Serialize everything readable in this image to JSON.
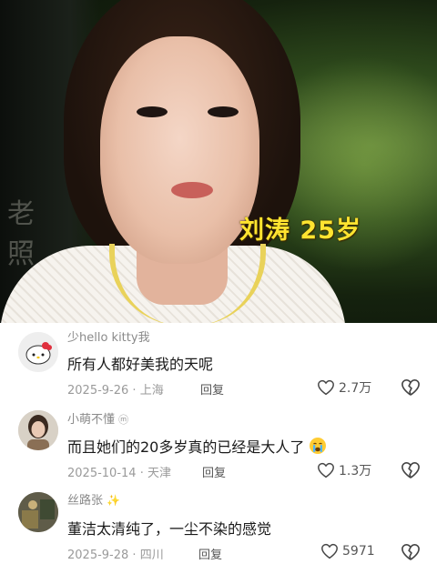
{
  "photo": {
    "caption": "刘涛 25岁",
    "watermark_glyphs": "老照"
  },
  "comments": [
    {
      "username": "少hello kitty我",
      "text": "所有人都好美我的天呢",
      "date": "2025-9-26",
      "location": "上海",
      "reply_label": "回复",
      "likes": "2.7万"
    },
    {
      "username": "小萌不懂",
      "text": "而且她们的20多岁真的已经是大人了",
      "date": "2025-10-14",
      "location": "天津",
      "reply_label": "回复",
      "likes": "1.3万"
    },
    {
      "username": "丝路张",
      "text": "董洁太清纯了，一尘不染的感觉",
      "date": "2025-9-28",
      "location": "四川",
      "reply_label": "回复",
      "likes": "5971"
    }
  ],
  "icons": {
    "like": "heart-outline-icon",
    "dislike": "broken-heart-icon",
    "emoji": "crying-face-emoji",
    "sparkle": "sparkle-icon"
  },
  "colors": {
    "caption": "#ffe430",
    "meta": "#9a9a9a",
    "name": "#8a8a8a"
  }
}
